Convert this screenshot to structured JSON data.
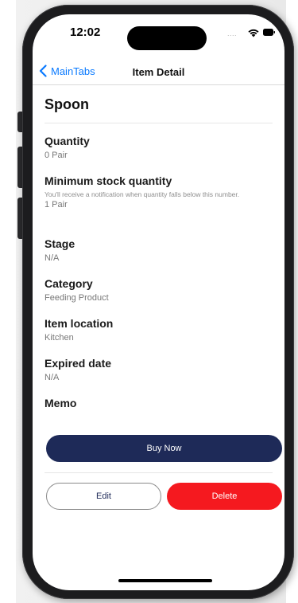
{
  "status_bar": {
    "time": "12:02",
    "signal_dots": "....",
    "icons": [
      "wifi-icon",
      "battery-icon"
    ]
  },
  "navbar": {
    "back_label": "MainTabs",
    "title": "Item Detail",
    "back_icon": "chevron-left-icon",
    "accent_color": "#0a7aff"
  },
  "item": {
    "name": "Spoon",
    "fields": [
      {
        "label": "Quantity",
        "value": "0 Pair"
      },
      {
        "label": "Minimum stock quantity",
        "note": "You'll receive a notification when quantity falls below this number.",
        "value": "1 Pair"
      },
      {
        "label": "Stage",
        "value": "N/A"
      },
      {
        "label": "Category",
        "value": "Feeding Product"
      },
      {
        "label": "Item location",
        "value": "Kitchen"
      },
      {
        "label": "Expired date",
        "value": "N/A"
      },
      {
        "label": "Memo",
        "value": ""
      }
    ]
  },
  "actions": {
    "buy_label": "Buy Now",
    "edit_label": "Edit",
    "delete_label": "Delete",
    "buy_color": "#1e2a58",
    "delete_color": "#f5191f"
  }
}
